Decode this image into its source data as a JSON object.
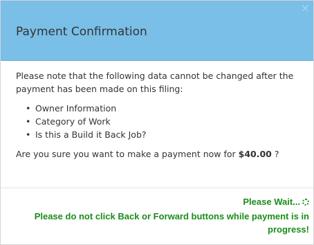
{
  "dialog": {
    "title": "Payment Confirmation",
    "close_label": "×"
  },
  "body": {
    "intro": "Please note that the following data cannot be changed after the payment has been made on this filing:",
    "items": [
      "Owner Information",
      "Category of Work",
      "Is this a Build it Back Job?"
    ],
    "question_prefix": "Are you sure you want to make a payment now for ",
    "amount": "$40.00",
    "question_suffix": " ?"
  },
  "footer": {
    "wait_text": "Please Wait...",
    "warning_text": "Please do not click Back or Forward buttons while payment is in progress!"
  },
  "colors": {
    "header_bg": "#79bfe8",
    "status_green": "#1a8c1a"
  },
  "icons": {
    "close": "close-icon",
    "spinner": "loading-spinner-icon"
  }
}
